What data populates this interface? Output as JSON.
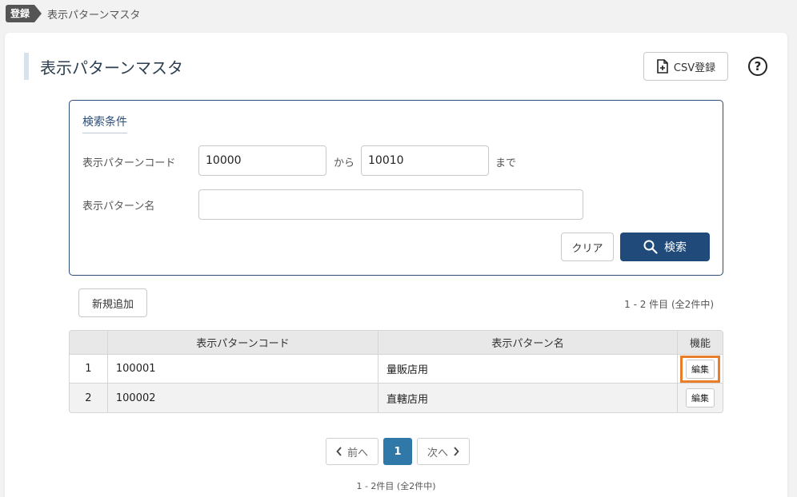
{
  "breadcrumb": {
    "tag": "登録",
    "current": "表示パターンマスタ"
  },
  "header": {
    "title": "表示パターンマスタ",
    "csv_label": "CSV登録",
    "help_glyph": "?"
  },
  "search": {
    "title": "検索条件",
    "code_label": "表示パターンコード",
    "code_from": "10000",
    "from_word": "から",
    "code_to": "10010",
    "to_word": "まで",
    "name_label": "表示パターン名",
    "name_value": "",
    "clear_label": "クリア",
    "search_label": "検索"
  },
  "toolbar": {
    "add_label": "新規追加",
    "count_text": "1 - 2 件目 (全2件中)"
  },
  "table": {
    "headers": [
      "",
      "表示パターンコード",
      "表示パターン名",
      "機能"
    ],
    "rows": [
      {
        "no": "1",
        "code": "100001",
        "name": "量販店用",
        "action": "編集"
      },
      {
        "no": "2",
        "code": "100002",
        "name": "直轄店用",
        "action": "編集"
      }
    ]
  },
  "pagination": {
    "prev_label": "前へ",
    "current_page": "1",
    "next_label": "次へ",
    "count_text": "1 - 2件目 (全2件中)"
  },
  "colors": {
    "primary": "#1f4a7a",
    "page_active": "#2f78a8",
    "highlight": "#e87d2a"
  }
}
